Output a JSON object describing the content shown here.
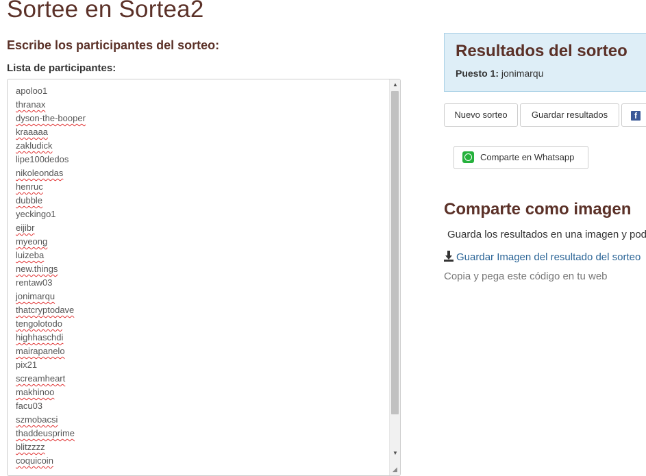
{
  "page": {
    "title": "Sortee en Sortea2",
    "subtitle": "Escribe los participantes del sorteo:",
    "list_label": "Lista de participantes:"
  },
  "participants": [
    {
      "name": "apoloo1",
      "spell": false
    },
    {
      "name": "thranax",
      "spell": true
    },
    {
      "name": "dyson-the-booper",
      "spell": true
    },
    {
      "name": "kraaaaa",
      "spell": true
    },
    {
      "name": "zakludick",
      "spell": true
    },
    {
      "name": "lipe100dedos",
      "spell": false
    },
    {
      "name": "nikoleondas",
      "spell": true
    },
    {
      "name": "henruc",
      "spell": true
    },
    {
      "name": "dubble",
      "spell": true
    },
    {
      "name": "yeckingo1",
      "spell": false
    },
    {
      "name": "eijibr",
      "spell": true
    },
    {
      "name": "myeong",
      "spell": true
    },
    {
      "name": "luizeba",
      "spell": true
    },
    {
      "name": "new.things",
      "spell": true
    },
    {
      "name": "rentaw03",
      "spell": false
    },
    {
      "name": "jonimarqu",
      "spell": true
    },
    {
      "name": "thatcryptodave",
      "spell": true
    },
    {
      "name": "tengolotodo",
      "spell": true
    },
    {
      "name": "highhaschdi",
      "spell": true
    },
    {
      "name": "mairapanelo",
      "spell": true
    },
    {
      "name": "pix21",
      "spell": false
    },
    {
      "name": "screamheart",
      "spell": true
    },
    {
      "name": "makhinoo",
      "spell": true
    },
    {
      "name": "facu03",
      "spell": false
    },
    {
      "name": "szmobacsi",
      "spell": true
    },
    {
      "name": "thaddeusprime",
      "spell": true
    },
    {
      "name": "blitzzzz",
      "spell": true
    },
    {
      "name": "coquicoin",
      "spell": true
    }
  ],
  "results": {
    "title": "Resultados del sorteo",
    "position_label": "Puesto 1:",
    "winner": "jonimarqu"
  },
  "buttons": {
    "new_draw": "Nuevo sorteo",
    "save_results": "Guardar resultados",
    "facebook_icon": "facebook-icon",
    "whatsapp": "Comparte en Whatsapp"
  },
  "share_image": {
    "title": "Comparte como imagen",
    "description": "Guarda los resultados en una imagen y pod",
    "download_link": "Guardar Imagen del resultado del sorteo",
    "embed_text": "Copia y pega este código en tu web"
  },
  "colors": {
    "heading": "#5b3128",
    "result_bg": "#deeef7",
    "link": "#2a6496",
    "whatsapp": "#25b13c",
    "facebook": "#3b5998"
  }
}
